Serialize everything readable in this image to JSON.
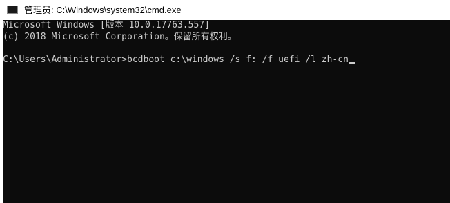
{
  "window": {
    "title": "管理员: C:\\Windows\\system32\\cmd.exe",
    "icon": "cmd-console-icon"
  },
  "console": {
    "lines": [
      "Microsoft Windows [版本 10.0.17763.557]",
      "(c) 2018 Microsoft Corporation。保留所有权利。"
    ],
    "prompt": "C:\\Users\\Administrator>",
    "command": "bcdboot c:\\windows /s f: /f uefi /l zh-cn",
    "background": "#0c0c0c",
    "foreground": "#cccccc"
  }
}
